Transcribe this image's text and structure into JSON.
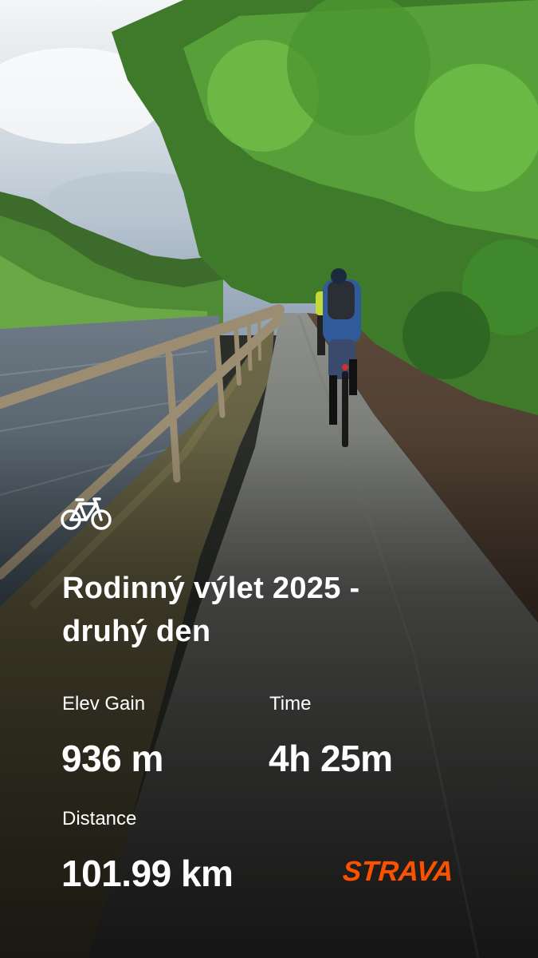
{
  "activity": {
    "icon": "bicycle-icon",
    "title_line1": "Rodinný výlet 2025 -",
    "title_line2": "druhý den"
  },
  "stats": {
    "elev_gain_label": "Elev Gain",
    "elev_gain_value": "936 m",
    "time_label": "Time",
    "time_value": "4h 25m",
    "distance_label": "Distance",
    "distance_value": "101.99 km"
  },
  "brand": {
    "logo_text": "STRAVA",
    "logo_color": "#fc5200"
  }
}
